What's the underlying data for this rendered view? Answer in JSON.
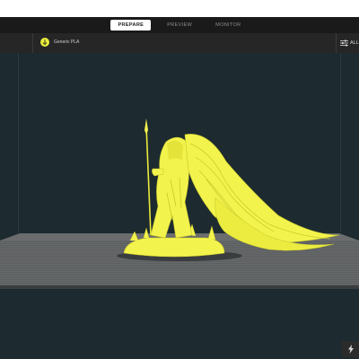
{
  "stages": {
    "tabs": [
      {
        "label": "PREPARE",
        "active": true
      },
      {
        "label": "PREVIEW",
        "active": false
      },
      {
        "label": "MONITOR",
        "active": false
      }
    ]
  },
  "header": {
    "profile": "Generic PLA",
    "printer_icon": "printer-icon",
    "settings_label": "ALL",
    "settings_icon": "sliders-icon"
  },
  "viewport": {
    "model_color": "#f3f34d",
    "plate_color": "#5b5d5e",
    "background_color": "#1d2b30",
    "action_icon": "lightning-icon"
  }
}
